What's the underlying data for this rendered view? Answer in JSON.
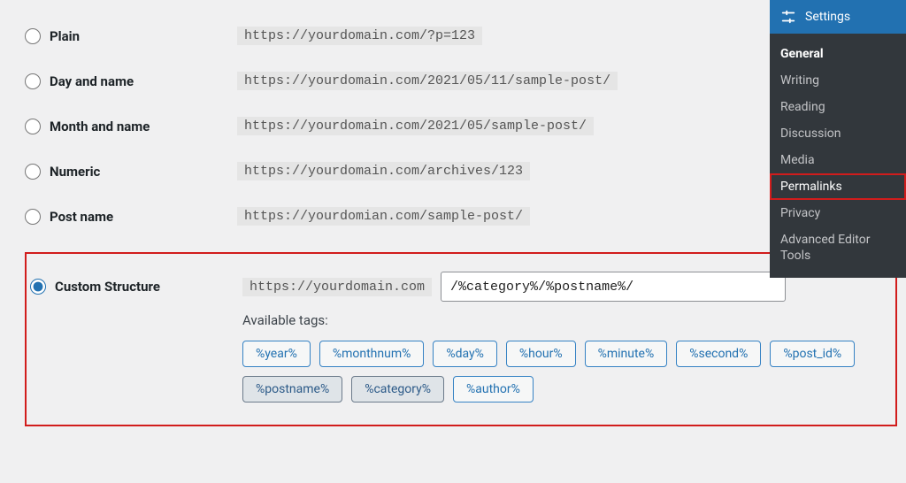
{
  "options": [
    {
      "id": "plain",
      "label": "Plain",
      "sample": "https://yourdomain.com/?p=123",
      "checked": false
    },
    {
      "id": "dayname",
      "label": "Day and name",
      "sample": "https://yourdomain.com/2021/05/11/sample-post/",
      "checked": false
    },
    {
      "id": "monthname",
      "label": "Month and name",
      "sample": "https://yourdomain.com/2021/05/sample-post/",
      "checked": false
    },
    {
      "id": "numeric",
      "label": "Numeric",
      "sample": "https://yourdomain.com/archives/123",
      "checked": false
    },
    {
      "id": "postname",
      "label": "Post name",
      "sample": "https://yourdomian.com/sample-post/",
      "checked": false
    }
  ],
  "custom": {
    "label": "Custom Structure",
    "prefix": "https://yourdomain.com",
    "value": "/%category%/%postname%/",
    "available_label": "Available tags:",
    "tags": [
      "%year%",
      "%monthnum%",
      "%day%",
      "%hour%",
      "%minute%",
      "%second%",
      "%post_id%"
    ],
    "tags_selected": [
      "%postname%",
      "%category%"
    ],
    "tags_after": [
      "%author%"
    ]
  },
  "sidebar": {
    "title": "Settings",
    "items": [
      {
        "label": "General",
        "current": true,
        "highlight": false
      },
      {
        "label": "Writing",
        "current": false,
        "highlight": false
      },
      {
        "label": "Reading",
        "current": false,
        "highlight": false
      },
      {
        "label": "Discussion",
        "current": false,
        "highlight": false
      },
      {
        "label": "Media",
        "current": false,
        "highlight": false
      },
      {
        "label": "Permalinks",
        "current": false,
        "highlight": true
      },
      {
        "label": "Privacy",
        "current": false,
        "highlight": false
      },
      {
        "label": "Advanced Editor Tools",
        "current": false,
        "highlight": false
      }
    ]
  }
}
